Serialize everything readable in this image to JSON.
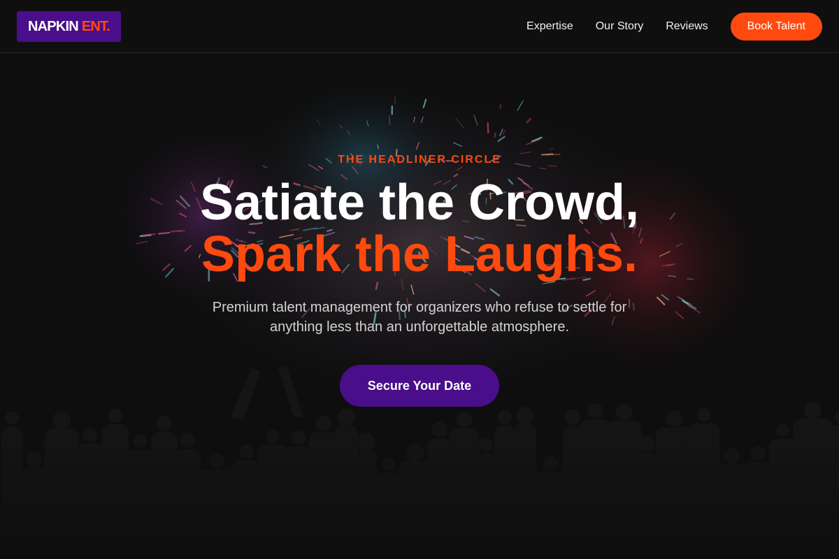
{
  "brand": {
    "name": "NAPKIN",
    "suffix": "ENT.",
    "logo_bg": "#4a0e8a",
    "accent": "#ff4a0f"
  },
  "nav": {
    "links": [
      "Expertise",
      "Our Story",
      "Reviews"
    ],
    "cta_label": "Book Talent"
  },
  "hero": {
    "eyebrow": "THE HEADLINER CIRCLE",
    "headline_line1": "Satiate the Crowd,",
    "headline_line2": "Spark the Laughs.",
    "subtext": "Premium talent management for organizers who refuse to settle for anything less than an unforgettable atmosphere.",
    "cta_label": "Secure Your Date",
    "background": "fireworks-over-crowd-photo"
  },
  "colors": {
    "background": "#0e0e0e",
    "primary_purple": "#4a0e8a",
    "accent_orange": "#ff4a0f",
    "text_light": "#d4d4d4"
  }
}
